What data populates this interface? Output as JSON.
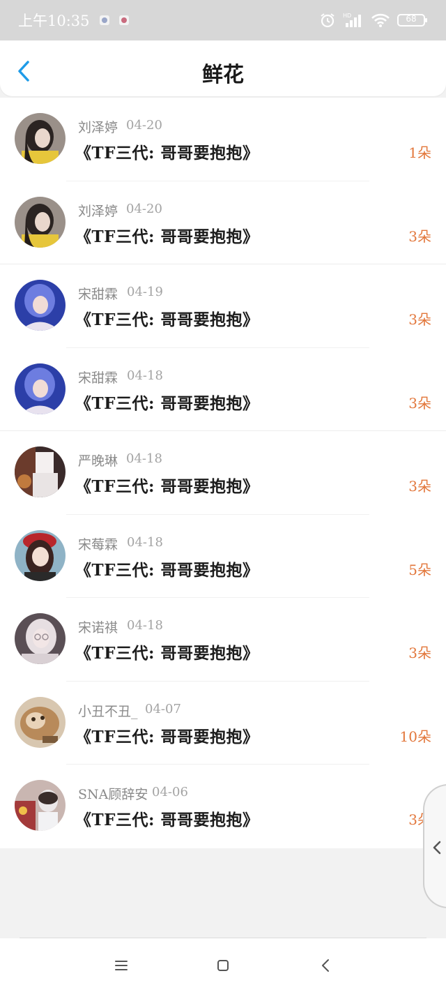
{
  "status_bar": {
    "time": "上午10:35",
    "battery": "68",
    "icons": [
      "notification-icon",
      "notification-icon",
      "alarm-icon",
      "hd-signal-icon",
      "wifi-icon",
      "battery-icon"
    ]
  },
  "header": {
    "title": "鲜花",
    "back_icon": "chevron-left-icon"
  },
  "colors": {
    "accent_blue": "#1e9be8",
    "count_orange": "#e2763a",
    "status_bar_bg": "#d7d7d7"
  },
  "gifts": [
    {
      "name": "刘泽婷",
      "date": "04-20",
      "title": "《TF三代: 哥哥要抱抱》",
      "count": "1朵"
    },
    {
      "name": "刘泽婷",
      "date": "04-20",
      "title": "《TF三代: 哥哥要抱抱》",
      "count": "3朵"
    },
    {
      "name": "宋甜霖",
      "date": "04-19",
      "title": "《TF三代: 哥哥要抱抱》",
      "count": "3朵"
    },
    {
      "name": "宋甜霖",
      "date": "04-18",
      "title": "《TF三代: 哥哥要抱抱》",
      "count": "3朵"
    },
    {
      "name": "严晚琳",
      "date": "04-18",
      "title": "《TF三代: 哥哥要抱抱》",
      "count": "3朵"
    },
    {
      "name": "宋莓霖",
      "date": "04-18",
      "title": "《TF三代: 哥哥要抱抱》",
      "count": "5朵"
    },
    {
      "name": "宋诺祺",
      "date": "04-18",
      "title": "《TF三代: 哥哥要抱抱》",
      "count": "3朵"
    },
    {
      "name": "小丑不丑_",
      "date": "04-07",
      "title": "《TF三代: 哥哥要抱抱》",
      "count": "10朵"
    },
    {
      "name": "SNA顾辞安",
      "date": "04-06",
      "title": "《TF三代: 哥哥要抱抱》",
      "count": "3朵"
    }
  ],
  "nav_bar": {
    "icons": [
      "menu-icon",
      "home-square-icon",
      "back-chevron-icon"
    ]
  }
}
